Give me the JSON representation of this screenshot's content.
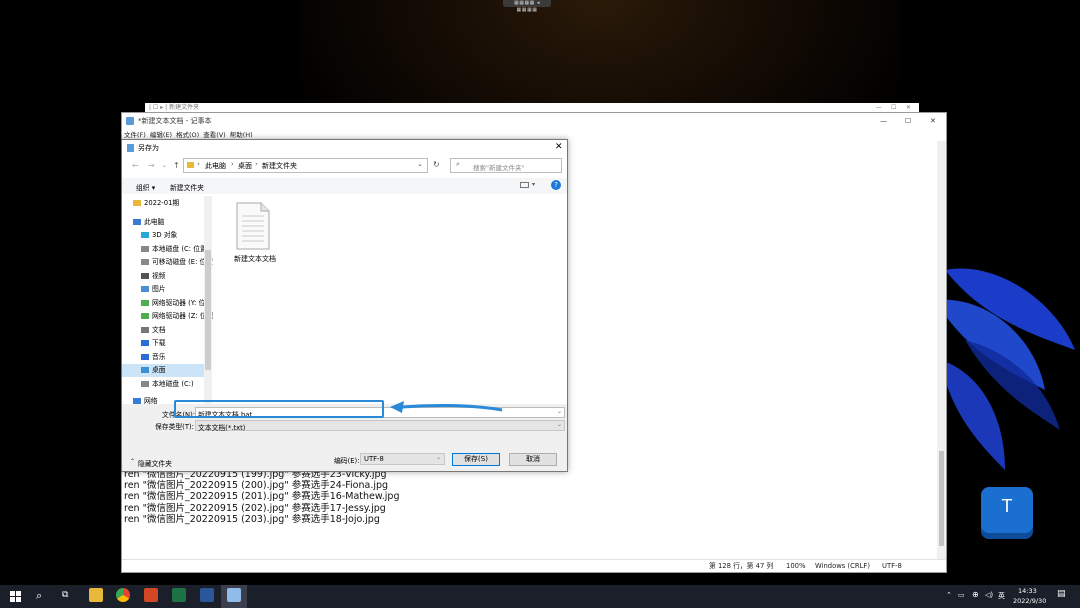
{
  "remote_bar": {
    "label": "▦▦▦▦ ◂ ▦▦▦▦"
  },
  "back_window": {
    "title": "| ☐ ▸ | 新建文件夹"
  },
  "notepad": {
    "title": "*新建文本文档 - 记事本",
    "menu": [
      "文件(F)",
      "编辑(E)",
      "格式(O)",
      "查看(V)",
      "帮助(H)"
    ],
    "lines": [
      "ren \"微信图片_20220915 (199).jpg\" 参赛选手23-Vicky.jpg",
      "ren \"微信图片_20220915 (200).jpg\" 参赛选手24-Fiona.jpg",
      "ren \"微信图片_20220915 (201).jpg\" 参赛选手16-Mathew.jpg",
      "ren \"微信图片_20220915 (202).jpg\" 参赛选手17-Jessy.jpg",
      "ren \"微信图片_20220915 (203).jpg\" 参赛选手18-Jojo.jpg"
    ],
    "status": {
      "position": "第 128 行，第 47 列",
      "zoom": "100%",
      "line_ending": "Windows (CRLF)",
      "encoding": "UTF-8"
    }
  },
  "dialog": {
    "title": "另存为",
    "breadcrumb": [
      "此电脑",
      "桌面",
      "新建文件夹"
    ],
    "search_placeholder": "搜索\"新建文件夹\"",
    "toolbar": {
      "organize": "组织 ▾",
      "new_folder": "新建文件夹"
    },
    "nav": [
      {
        "label": "2022-01期",
        "icon": "folder-icon",
        "color": "#e8b83a"
      },
      {
        "label": "此电脑",
        "icon": "computer-icon",
        "color": "#3a7bd5"
      },
      {
        "label": "3D 对象",
        "icon": "cube-icon",
        "color": "#2aa6d6"
      },
      {
        "label": "本地磁盘 (C: 位置",
        "icon": "drive-icon",
        "color": "#888888"
      },
      {
        "label": "可移动磁盘 (E: 位置",
        "icon": "usb-drive-icon",
        "color": "#888888"
      },
      {
        "label": "视频",
        "icon": "video-icon",
        "color": "#555555"
      },
      {
        "label": "图片",
        "icon": "pictures-icon",
        "color": "#4a8fd1"
      },
      {
        "label": "网络驱动器 (Y: 位置",
        "icon": "network-drive-icon",
        "color": "#4caf50"
      },
      {
        "label": "网络驱动器 (Z: 位置",
        "icon": "network-drive-icon",
        "color": "#4caf50"
      },
      {
        "label": "文档",
        "icon": "documents-icon",
        "color": "#777777"
      },
      {
        "label": "下载",
        "icon": "download-icon",
        "color": "#2a6fd6"
      },
      {
        "label": "音乐",
        "icon": "music-icon",
        "color": "#2a6fd6"
      },
      {
        "label": "桌面",
        "icon": "desktop-icon",
        "color": "#3a8fd9",
        "selected": true
      },
      {
        "label": "本地磁盘 (C:)",
        "icon": "drive-icon",
        "color": "#888888"
      },
      {
        "label": "网络",
        "icon": "network-icon",
        "color": "#3a7bd5"
      }
    ],
    "files": [
      {
        "name": "新建文本文档"
      }
    ],
    "filename_label": "文件名(N):",
    "filename_value": "新建文本文档.bat",
    "filetype_label": "保存类型(T):",
    "filetype_value": "文本文档(*.txt)",
    "hide_folders": "隐藏文件夹",
    "encoding_label": "编码(E):",
    "encoding_value": "UTF-8",
    "save": "保存(S)",
    "cancel": "取消"
  },
  "desktop_app": {
    "label": "T"
  },
  "taskbar": {
    "apps": [
      "file-explorer-icon",
      "chrome-icon",
      "powerpoint-icon",
      "excel-icon",
      "word-icon",
      "notepad-icon"
    ],
    "tray": {
      "input_method": "英",
      "time": "14:33",
      "date": "2022/9/30"
    }
  },
  "colors": {
    "accent": "#0078d7",
    "highlight_box": "#2a8ad8",
    "arrow": "#2a8ad8",
    "taskbar": "#1b1f29"
  }
}
